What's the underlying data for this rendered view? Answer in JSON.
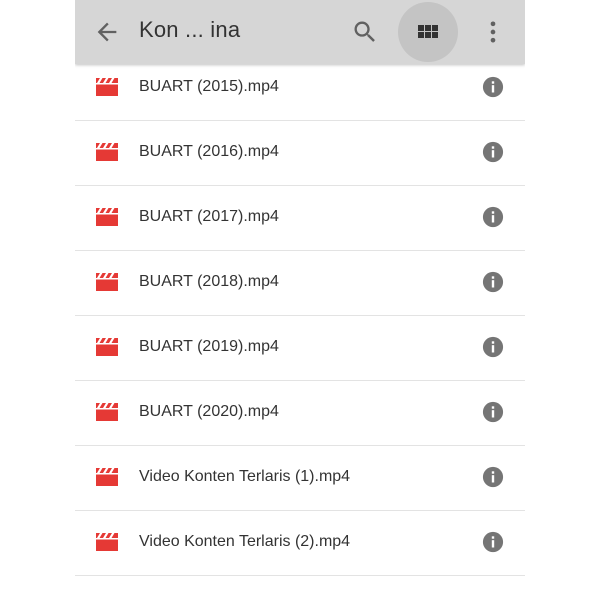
{
  "appbar": {
    "title": "Kon ... ina",
    "icons": {
      "back": "arrow-back-icon",
      "search": "search-icon",
      "view": "grid-view-icon",
      "more": "more-vert-icon"
    },
    "background": "#d6d6d6"
  },
  "files": [
    {
      "name": "BUART (2015).mp4",
      "icon": "video-file-icon"
    },
    {
      "name": "BUART (2016).mp4",
      "icon": "video-file-icon"
    },
    {
      "name": "BUART (2017).mp4",
      "icon": "video-file-icon"
    },
    {
      "name": "BUART (2018).mp4",
      "icon": "video-file-icon"
    },
    {
      "name": "BUART (2019).mp4",
      "icon": "video-file-icon"
    },
    {
      "name": "BUART (2020).mp4",
      "icon": "video-file-icon"
    },
    {
      "name": "Video Konten Terlaris (1).mp4",
      "icon": "video-file-icon"
    },
    {
      "name": "Video Konten Terlaris (2).mp4",
      "icon": "video-file-icon"
    }
  ],
  "colors": {
    "video_icon": "#e53935",
    "info_icon": "#757575",
    "text": "#333333",
    "divider": "#e3e3e3"
  }
}
